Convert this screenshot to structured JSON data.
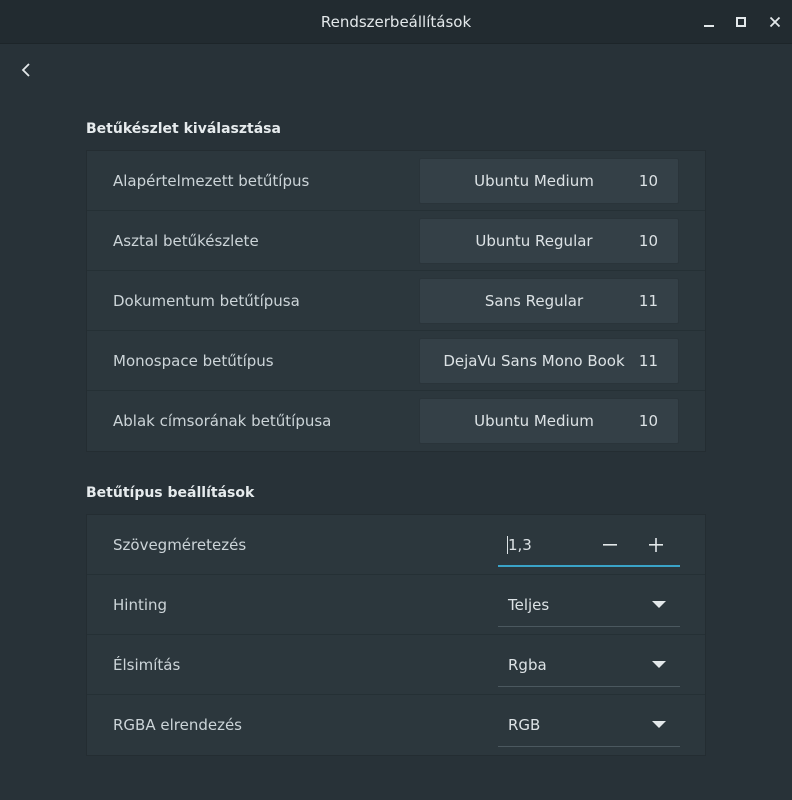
{
  "window": {
    "title": "Rendszerbeállítások"
  },
  "fonts_section": {
    "title": "Betűkészlet kiválasztása",
    "rows": [
      {
        "label": "Alapértelmezett betűtípus",
        "font": "Ubuntu Medium",
        "size": "10"
      },
      {
        "label": "Asztal betűkészlete",
        "font": "Ubuntu Regular",
        "size": "10"
      },
      {
        "label": "Dokumentum betűtípusa",
        "font": "Sans Regular",
        "size": "11"
      },
      {
        "label": "Monospace betűtípus",
        "font": "DejaVu Sans Mono Book",
        "size": "11"
      },
      {
        "label": "Ablak címsorának betűtípusa",
        "font": "Ubuntu Medium",
        "size": "10"
      }
    ]
  },
  "settings_section": {
    "title": "Betűtípus beállítások",
    "scaling": {
      "label": "Szövegméretezés",
      "value": "1,3"
    },
    "hinting": {
      "label": "Hinting",
      "value": "Teljes"
    },
    "antialiasing": {
      "label": "Élsimítás",
      "value": "Rgba"
    },
    "rgba_order": {
      "label": "RGBA elrendezés",
      "value": "RGB"
    }
  },
  "colors": {
    "background": "#283238",
    "card": "#2c373d",
    "accent": "#3aa3c8"
  }
}
